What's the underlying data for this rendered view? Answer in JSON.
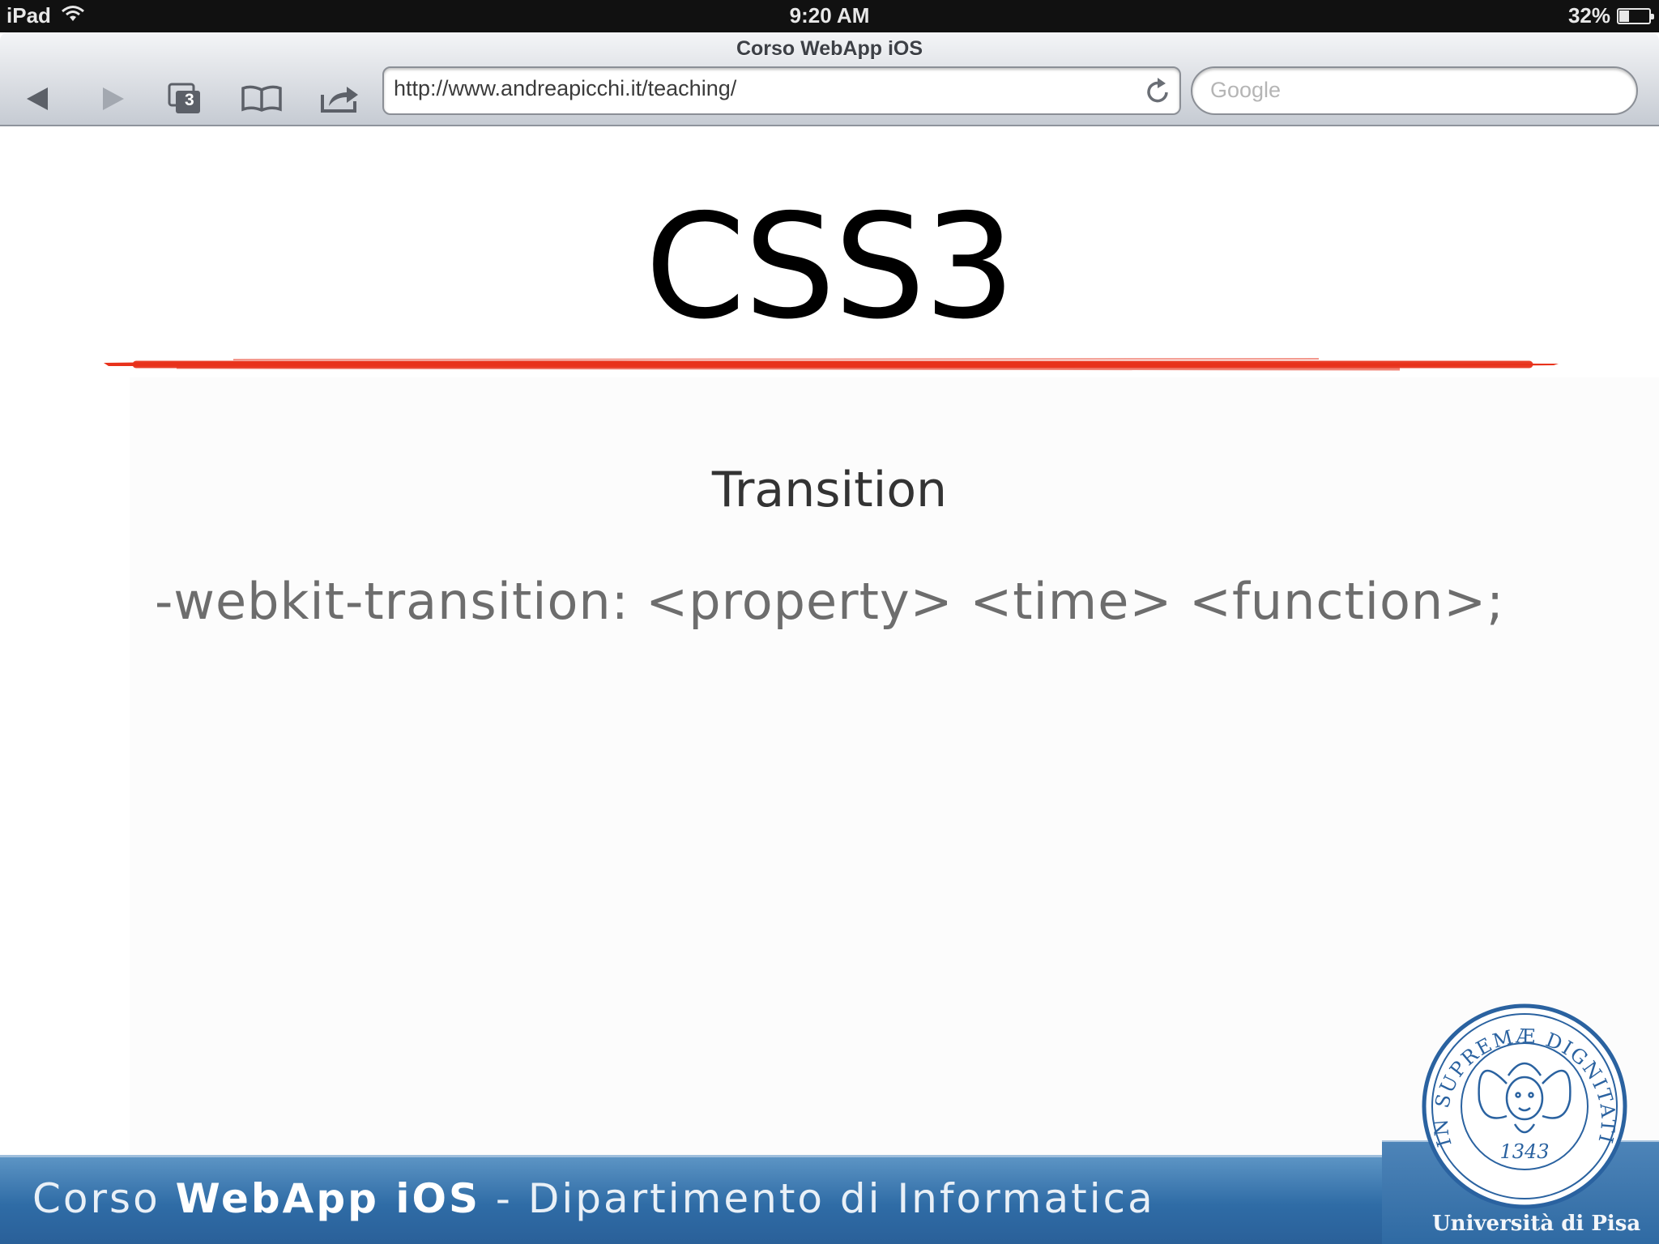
{
  "status_bar": {
    "device": "iPad",
    "time": "9:20 AM",
    "battery": "32%",
    "battery_level": 0.32
  },
  "browser": {
    "title": "Corso WebApp iOS",
    "tabs_count": "3",
    "url": "http://www.andreapicchi.it/teaching/",
    "search_placeholder": "Google"
  },
  "slide": {
    "title": "CSS3",
    "subtitle": "Transition",
    "code": "-webkit-transition: <property> <time> <function>;",
    "accent_color": "#e8321b"
  },
  "footer": {
    "course_prefix": "Corso ",
    "course_name": "WebApp iOS",
    "department": " - Dipartimento di Informatica",
    "university": "Università di Pisa",
    "seal_motto": "IN SUPREMÆ DIGNITATIS",
    "seal_year": "1343"
  }
}
